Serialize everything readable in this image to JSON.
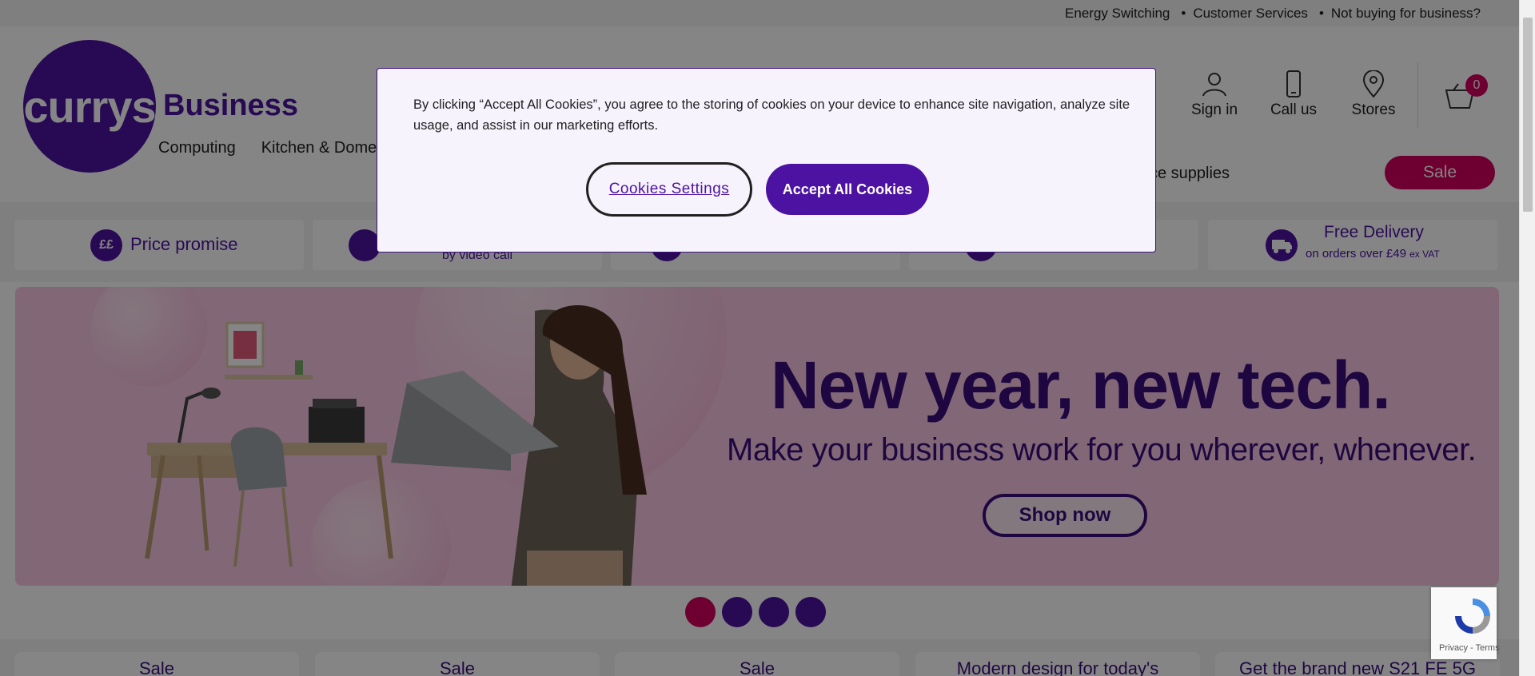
{
  "utility_bar": {
    "links": [
      "Energy Switching",
      "Customer Services",
      "Not buying for business?"
    ],
    "separator": "•"
  },
  "header": {
    "logo_text": "currys",
    "logo_suffix": "Business",
    "icons": [
      {
        "label": "Sign in",
        "icon": "user-icon"
      },
      {
        "label": "Call us",
        "icon": "phone-icon"
      },
      {
        "label": "Stores",
        "icon": "location-pin-icon"
      }
    ],
    "basket_count": "0"
  },
  "nav": {
    "items": [
      "Computing",
      "Kitchen & Dome"
    ],
    "right_item": "fice supplies",
    "sale_label": "Sale"
  },
  "usp": {
    "items": [
      {
        "icon_text": "££",
        "title": "Price promise",
        "subtitle": ""
      },
      {
        "icon_text": "",
        "title": "",
        "subtitle": "by video call"
      },
      {
        "icon_text": "",
        "title": "",
        "subtitle": ""
      },
      {
        "icon_text": "",
        "title": "",
        "subtitle": ""
      },
      {
        "icon_text": "",
        "title": "Free Delivery",
        "subtitle": "on orders over £49",
        "subtitle_suffix": "ex VAT"
      }
    ]
  },
  "hero": {
    "title": "New year, new tech.",
    "subtitle": "Make your business work for you wherever, whenever.",
    "cta_label": "Shop now",
    "background_color": "#f9c7e2"
  },
  "carousel": {
    "slides": 4,
    "active_index": 0
  },
  "cards": [
    "Sale",
    "Sale",
    "Sale",
    "Modern design for today's",
    "Get the brand new S21 FE 5G"
  ],
  "cookie_modal": {
    "text": "By clicking “Accept All Cookies”, you agree to the storing of cookies on your device to enhance site navigation, analyze site usage, and assist in our marketing efforts.",
    "settings_label": "Cookies Settings",
    "accept_label": "Accept All Cookies"
  },
  "recaptcha": {
    "privacy": "Privacy",
    "terms": "Terms",
    "separator": "-"
  },
  "colors": {
    "brand_purple": "#4c12a1",
    "brand_pink": "#d1005d",
    "hero_pink": "#f9c7e2",
    "deep_purple": "#3b0f7e"
  }
}
